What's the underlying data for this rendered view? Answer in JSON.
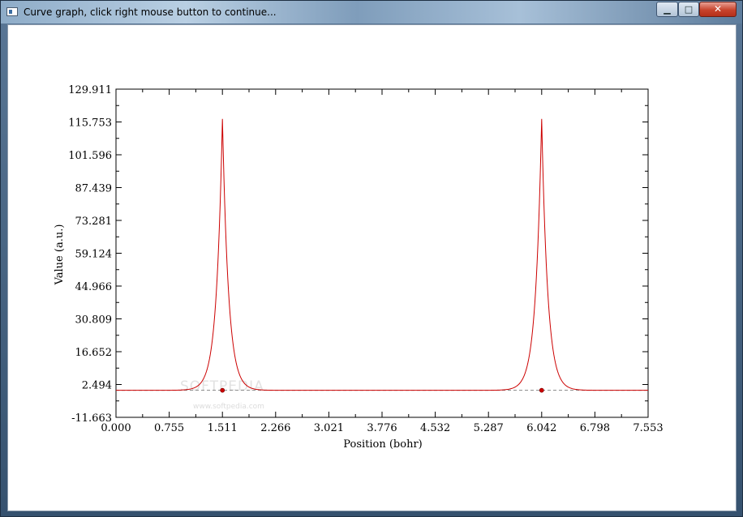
{
  "window": {
    "title": "Curve graph, click right mouse button to continue...",
    "minimize_glyph": "▁",
    "maximize_glyph": "□",
    "close_glyph": "✕"
  },
  "watermark": {
    "brand": "SOFTPEDIA",
    "url": "www.softpedia.com"
  },
  "chart_data": {
    "type": "line",
    "xlabel": "Position (bohr)",
    "ylabel": "Value (a.u.)",
    "xlim": [
      0.0,
      7.553
    ],
    "ylim": [
      -11.663,
      129.911
    ],
    "x_ticks": [
      "0.000",
      "0.755",
      "1.511",
      "2.266",
      "3.021",
      "3.776",
      "4.532",
      "5.287",
      "6.042",
      "6.798",
      "7.553"
    ],
    "y_ticks": [
      "129.911",
      "115.753",
      "101.596",
      "87.439",
      "73.281",
      "59.124",
      "44.966",
      "30.809",
      "16.652",
      "2.494",
      "-11.663"
    ],
    "grid": false,
    "line_color": "#cc0000",
    "marker_color": "#cc0000",
    "baseline_value": 0.0,
    "peaks": [
      {
        "x": 1.511,
        "y": 117.6
      },
      {
        "x": 6.042,
        "y": 117.6
      }
    ],
    "markers": [
      {
        "x": 1.511,
        "y": 0.0
      },
      {
        "x": 6.042,
        "y": 0.0
      }
    ]
  }
}
